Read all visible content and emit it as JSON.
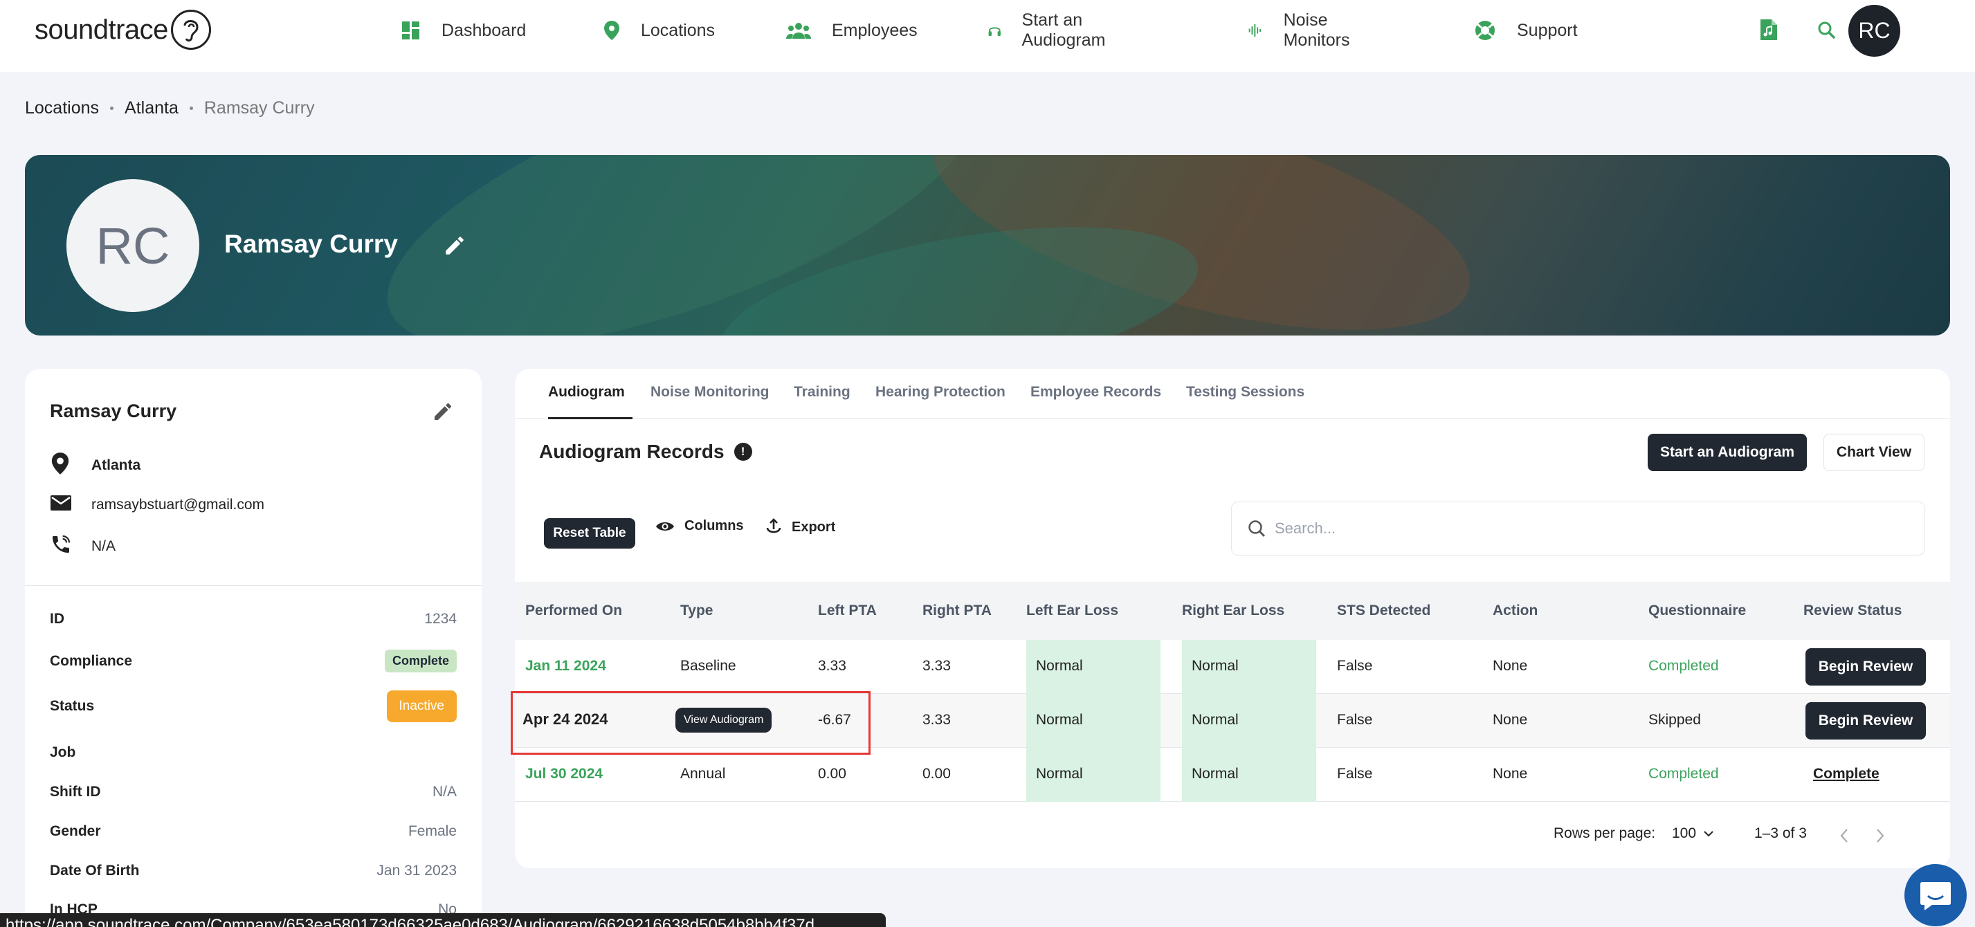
{
  "app": {
    "logo_text": "soundtrace"
  },
  "nav": {
    "items": [
      {
        "label": "Dashboard",
        "icon": "dashboard-icon"
      },
      {
        "label": "Locations",
        "icon": "location-pin-icon"
      },
      {
        "label": "Employees",
        "icon": "people-icon"
      },
      {
        "label": "Start an Audiogram",
        "icon": "headphones-icon"
      },
      {
        "label": "Noise Monitors",
        "icon": "waveform-icon"
      },
      {
        "label": "Support",
        "icon": "lifebuoy-icon"
      }
    ],
    "avatar_initials": "RC"
  },
  "breadcrumb": {
    "items": [
      "Locations",
      "Atlanta",
      "Ramsay Curry"
    ]
  },
  "banner": {
    "initials": "RC",
    "name": "Ramsay Curry"
  },
  "profile": {
    "name": "Ramsay Curry",
    "location": "Atlanta",
    "email": "ramsaybstuart@gmail.com",
    "phone": "N/A",
    "fields": {
      "id": {
        "label": "ID",
        "value": "1234"
      },
      "compliance": {
        "label": "Compliance",
        "value": "Complete"
      },
      "status": {
        "label": "Status",
        "value": "Inactive"
      },
      "job": {
        "label": "Job",
        "value": ""
      },
      "shift": {
        "label": "Shift ID",
        "value": "N/A"
      },
      "gender": {
        "label": "Gender",
        "value": "Female"
      },
      "dob": {
        "label": "Date Of Birth",
        "value": "Jan 31 2023"
      },
      "hcp": {
        "label": "In HCP",
        "value": "No"
      }
    }
  },
  "tabs": [
    "Audiogram",
    "Noise Monitoring",
    "Training",
    "Hearing Protection",
    "Employee Records",
    "Testing Sessions"
  ],
  "records": {
    "title": "Audiogram Records",
    "start_button": "Start an Audiogram",
    "chart_button": "Chart View",
    "reset_button": "Reset Table",
    "columns_button": "Columns",
    "export_button": "Export",
    "search_placeholder": "Search...",
    "headers": [
      "Performed On",
      "Type",
      "Left PTA",
      "Right PTA",
      "Left Ear Loss",
      "Right Ear Loss",
      "STS Detected",
      "Action",
      "Questionnaire",
      "Review Status"
    ],
    "rows": [
      {
        "date": "Jan 11 2024",
        "type": "Baseline",
        "left_pta": "3.33",
        "right_pta": "3.33",
        "left_loss": "Normal",
        "right_loss": "Normal",
        "sts": "False",
        "action": "None",
        "questionnaire": "Completed",
        "review": "Begin Review"
      },
      {
        "date": "Apr 24 2024",
        "type": "",
        "left_pta": "-6.67",
        "right_pta": "3.33",
        "left_loss": "Normal",
        "right_loss": "Normal",
        "sts": "False",
        "action": "None",
        "questionnaire": "Skipped",
        "review": "Begin Review",
        "tooltip": "View Audiogram"
      },
      {
        "date": "Jul 30 2024",
        "type": "Annual",
        "left_pta": "0.00",
        "right_pta": "0.00",
        "left_loss": "Normal",
        "right_loss": "Normal",
        "sts": "False",
        "action": "None",
        "questionnaire": "Completed",
        "review": "Complete"
      }
    ],
    "pager": {
      "rows_label": "Rows per page:",
      "rows_value": "100",
      "range": "1–3 of 3"
    }
  },
  "statusbar": {
    "url": "https://app.soundtrace.com/Company/653ea580173d66325ae0d683/Audiogram/6629216638d5054b8bb4f37d"
  }
}
